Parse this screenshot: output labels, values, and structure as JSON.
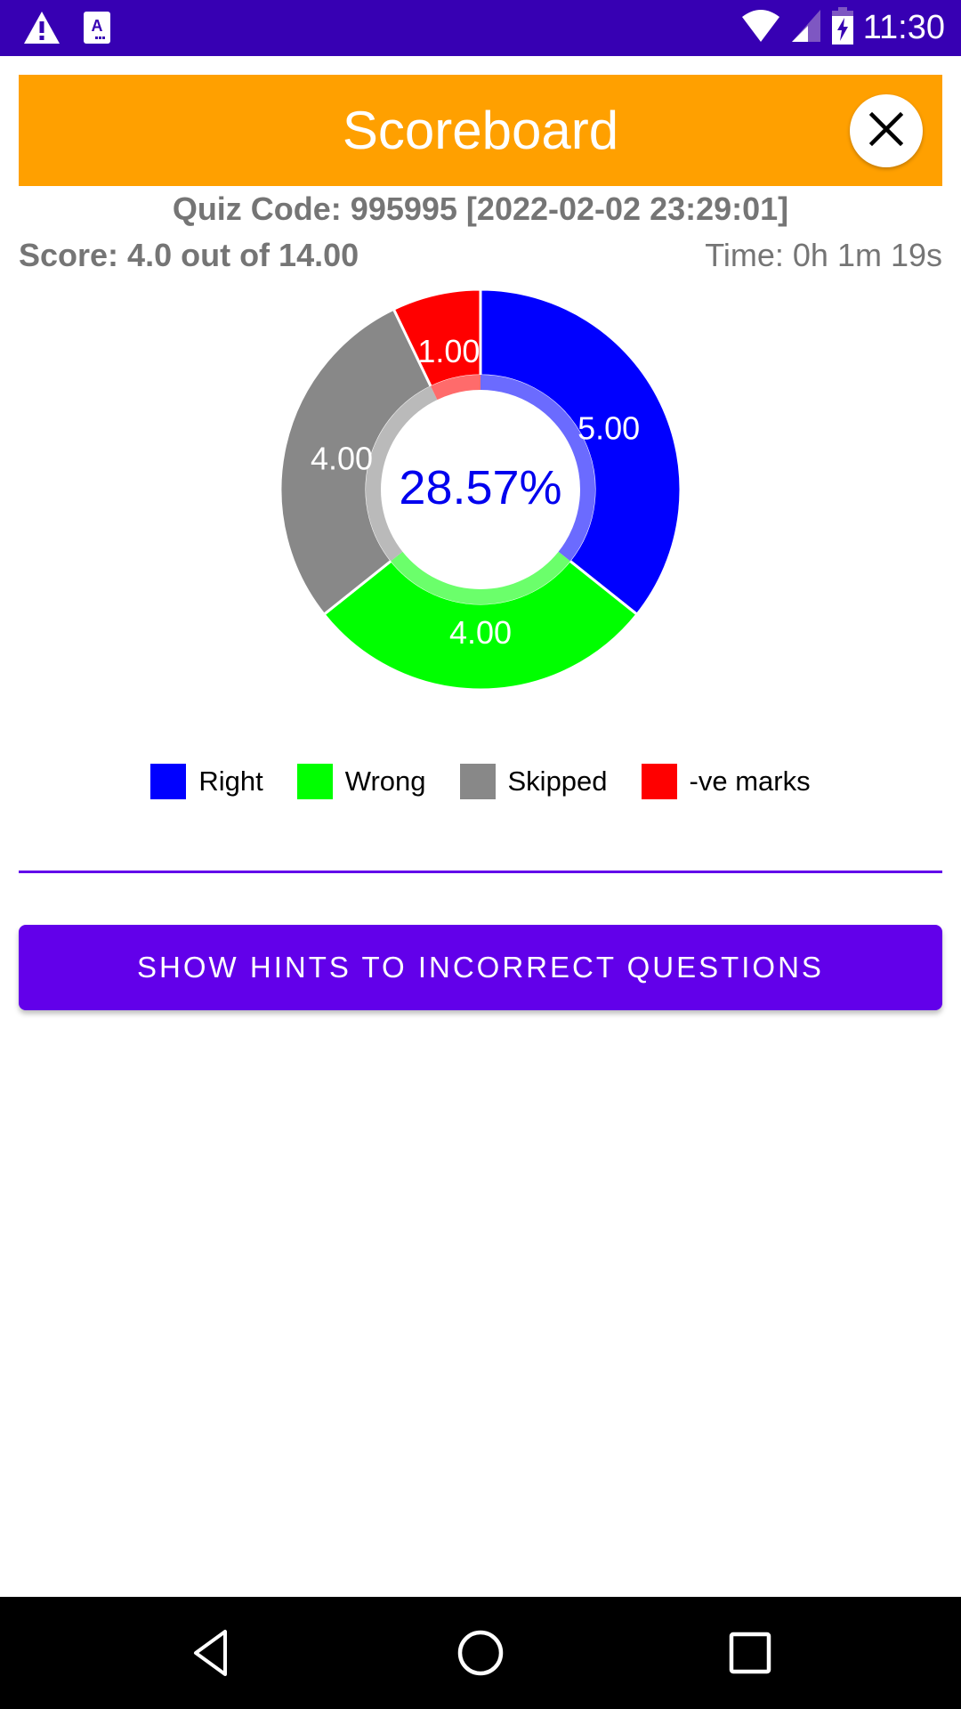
{
  "status_bar": {
    "time": "11:30",
    "left_icons": [
      "warning-icon",
      "a-notification-icon"
    ],
    "right_icons": [
      "wifi-icon",
      "signal-icon",
      "battery-charging-icon"
    ]
  },
  "header": {
    "title": "Scoreboard",
    "close_icon": "close-icon",
    "background_color": "#ffa000"
  },
  "info": {
    "quiz_code": "Quiz Code: 995995 [2022-02-02 23:29:01]",
    "score": "Score: 4.0 out of 14.00",
    "time": "Time: 0h 1m 19s"
  },
  "chart_data": {
    "type": "pie",
    "variant": "donut",
    "center_label": "28.57%",
    "center_label_color": "#0000ee",
    "categories": [
      "Right",
      "Wrong",
      "Skipped",
      "-ve marks"
    ],
    "values": [
      5.0,
      4.0,
      4.0,
      1.0
    ],
    "value_labels": [
      "5.00",
      "4.00",
      "4.00",
      "1.00"
    ],
    "colors": [
      "#0000ff",
      "#00ff00",
      "#888888",
      "#ff0000"
    ],
    "start": "top",
    "direction": "clockwise",
    "legend_position": "bottom"
  },
  "legend": [
    {
      "label": "Right",
      "color": "#0000ff"
    },
    {
      "label": "Wrong",
      "color": "#00ff00"
    },
    {
      "label": "Skipped",
      "color": "#888888"
    },
    {
      "label": "-ve marks",
      "color": "#ff0000"
    }
  ],
  "actions": {
    "show_hints_label": "SHOW HINTS TO INCORRECT QUESTIONS",
    "accent_color": "#6200ea"
  },
  "nav_bar": {
    "buttons": [
      "back-icon",
      "home-icon",
      "recents-icon"
    ]
  }
}
